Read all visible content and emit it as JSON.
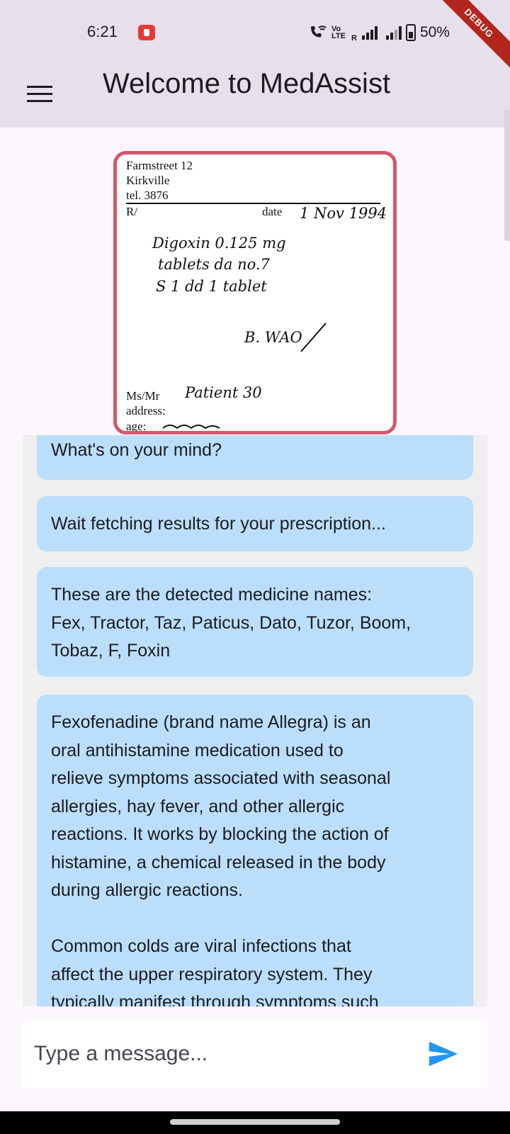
{
  "status_bar": {
    "time": "6:21",
    "volte_top": "Vo",
    "volte_bottom": "LTE",
    "signal_label": "R",
    "battery": "50%",
    "debug_label": "DEBUG"
  },
  "app_bar": {
    "title": "Welcome to MedAssist",
    "menu_icon": "hamburger-menu-icon"
  },
  "prescription": {
    "address_line_1": "Farmstreet 12",
    "address_line_2": "Kirkville",
    "phone": "tel. 3876",
    "rx_label": "R/",
    "date_label": "date",
    "date_value": "1 Nov 1994",
    "line_1": "Digoxin 0.125 mg",
    "line_2": "tablets da no.7",
    "line_3": "S 1 dd 1 tablet",
    "signature": "B. WAO",
    "patient_label": "Ms/Mr",
    "patient_value": "Patient 30",
    "address_label": "address:",
    "age_label": "age:"
  },
  "chat": {
    "messages": [
      {
        "text": "What's on your mind?"
      },
      {
        "text": "Wait fetching results for your prescription..."
      },
      {
        "text": "These are the detected medicine names:\nFex, Tractor, Taz, Paticus, Dato, Tuzor, Boom,\nTobaz, F, Foxin"
      },
      {
        "text": "Fexofenadine (brand name Allegra) is an\noral antihistamine medication used to\nrelieve symptoms associated with seasonal\nallergies, hay fever, and other allergic\nreactions. It works by blocking the action of\nhistamine, a chemical released in the body\nduring allergic reactions.\n\nCommon colds are viral infections that\naffect the upper respiratory system. They\ntypically manifest through symptoms such"
      }
    ]
  },
  "input": {
    "placeholder": "Type a message...",
    "value": ""
  },
  "colors": {
    "app_bar": "#e7e0ec",
    "bubble": "#bbdefb",
    "chat_bg": "#efefef",
    "image_border": "#d4576d",
    "send_icon": "#2196f3",
    "debug_ribbon": "#b3261e"
  },
  "icons": {
    "send": "send-icon",
    "record": "screen-record-icon",
    "wifi_calling": "wifi-calling-icon",
    "battery": "battery-icon"
  }
}
